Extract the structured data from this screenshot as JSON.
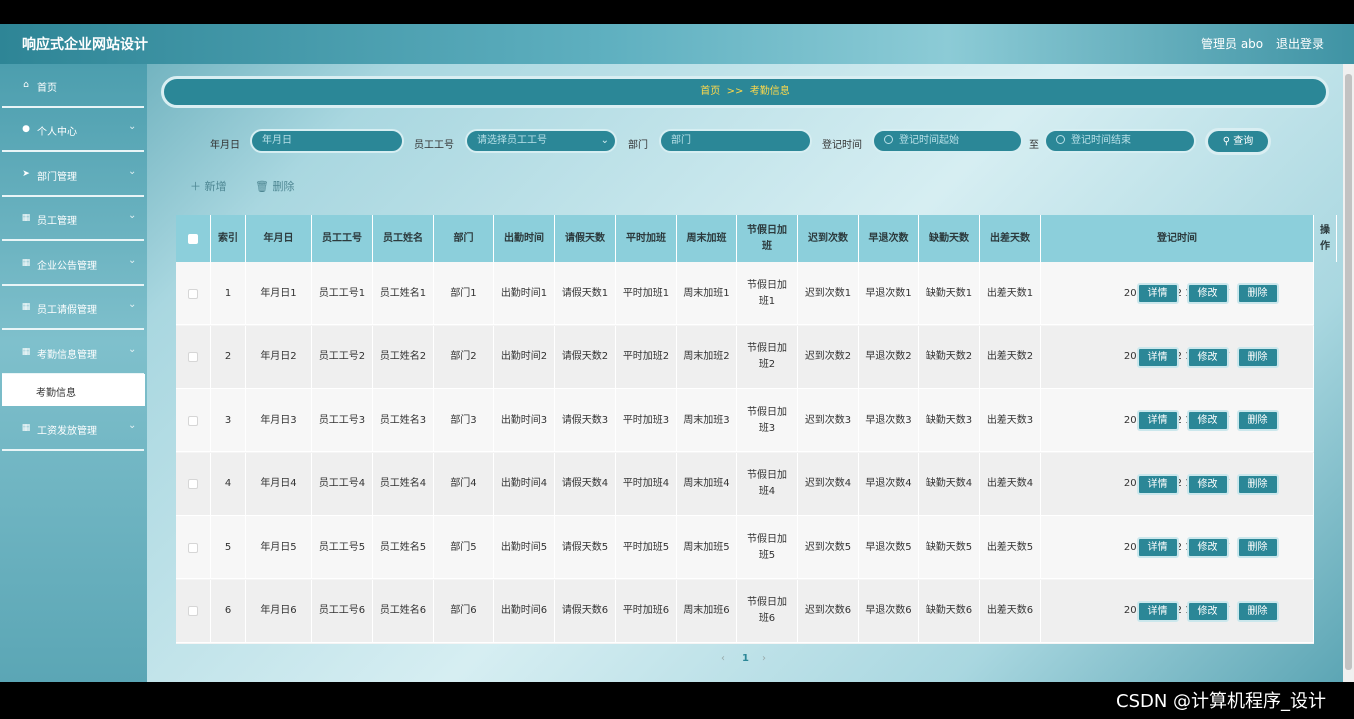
{
  "app": {
    "title": "响应式企业网站设计",
    "admin": "管理员 abo",
    "logout": "退出登录"
  },
  "sidebar": {
    "items": [
      {
        "label": "首页",
        "icon": "home-icon",
        "glyph": "⌂"
      },
      {
        "label": "个人中心",
        "icon": "user-icon",
        "glyph": "●"
      },
      {
        "label": "部门管理",
        "icon": "send-icon",
        "glyph": "➤"
      },
      {
        "label": "员工管理",
        "icon": "grid-icon",
        "glyph": "▦"
      },
      {
        "label": "企业公告管理",
        "icon": "grid-icon",
        "glyph": "▦"
      },
      {
        "label": "员工请假管理",
        "icon": "grid-icon",
        "glyph": "▦"
      },
      {
        "label": "考勤信息管理",
        "icon": "grid-icon",
        "glyph": "▦"
      },
      {
        "label": "工资发放管理",
        "icon": "grid-icon",
        "glyph": "▦"
      }
    ],
    "sub_active": "考勤信息"
  },
  "breadcrumb": {
    "home": "首页",
    "sep": ">>",
    "current": "考勤信息"
  },
  "search": {
    "date_label": "年月日",
    "date_placeholder": "年月日",
    "emp_label": "员工工号",
    "emp_placeholder": "请选择员工工号",
    "dept_label": "部门",
    "dept_placeholder": "部门",
    "reg_label": "登记时间",
    "reg_start": "登记时间起始",
    "to": "至",
    "reg_end": "登记时间结束",
    "query": "查询"
  },
  "toolbar": {
    "add": "新增",
    "delete": "删除"
  },
  "table": {
    "headers": [
      "索引",
      "年月日",
      "员工工号",
      "员工姓名",
      "部门",
      "出勤时间",
      "请假天数",
      "平时加班",
      "周末加班",
      "节假日加班",
      "迟到次数",
      "早退次数",
      "缺勤天数",
      "出差天数",
      "登记时间",
      "操作"
    ],
    "rows": [
      [
        "1",
        "年月日1",
        "员工工号1",
        "员工姓名1",
        "部门1",
        "出勤时间1",
        "请假天数1",
        "平时加班1",
        "周末加班1",
        "节假日加班1",
        "迟到次数1",
        "早退次数1",
        "缺勤天数1",
        "出差天数1",
        "2022-03-02 14:05:37"
      ],
      [
        "2",
        "年月日2",
        "员工工号2",
        "员工姓名2",
        "部门2",
        "出勤时间2",
        "请假天数2",
        "平时加班2",
        "周末加班2",
        "节假日加班2",
        "迟到次数2",
        "早退次数2",
        "缺勤天数2",
        "出差天数2",
        "2022-03-02 14:05:37"
      ],
      [
        "3",
        "年月日3",
        "员工工号3",
        "员工姓名3",
        "部门3",
        "出勤时间3",
        "请假天数3",
        "平时加班3",
        "周末加班3",
        "节假日加班3",
        "迟到次数3",
        "早退次数3",
        "缺勤天数3",
        "出差天数3",
        "2022-03-02 14:05:37"
      ],
      [
        "4",
        "年月日4",
        "员工工号4",
        "员工姓名4",
        "部门4",
        "出勤时间4",
        "请假天数4",
        "平时加班4",
        "周末加班4",
        "节假日加班4",
        "迟到次数4",
        "早退次数4",
        "缺勤天数4",
        "出差天数4",
        "2022-03-02 14:05:37"
      ],
      [
        "5",
        "年月日5",
        "员工工号5",
        "员工姓名5",
        "部门5",
        "出勤时间5",
        "请假天数5",
        "平时加班5",
        "周末加班5",
        "节假日加班5",
        "迟到次数5",
        "早退次数5",
        "缺勤天数5",
        "出差天数5",
        "2022-03-02 14:05:37"
      ],
      [
        "6",
        "年月日6",
        "员工工号6",
        "员工姓名6",
        "部门6",
        "出勤时间6",
        "请假天数6",
        "平时加班6",
        "周末加班6",
        "节假日加班6",
        "迟到次数6",
        "早退次数6",
        "缺勤天数6",
        "出差天数6",
        "2022-03-02 14:05:37"
      ]
    ],
    "actions": [
      "详情",
      "修改",
      "删除"
    ]
  },
  "pagination": {
    "prev": "‹",
    "page": "1",
    "next": "›"
  },
  "watermark": "CSDN @计算机程序_设计",
  "colors": {
    "accent": "#2b8797",
    "highlight": "#ffd94a",
    "header_row": "#8ccfdb"
  }
}
